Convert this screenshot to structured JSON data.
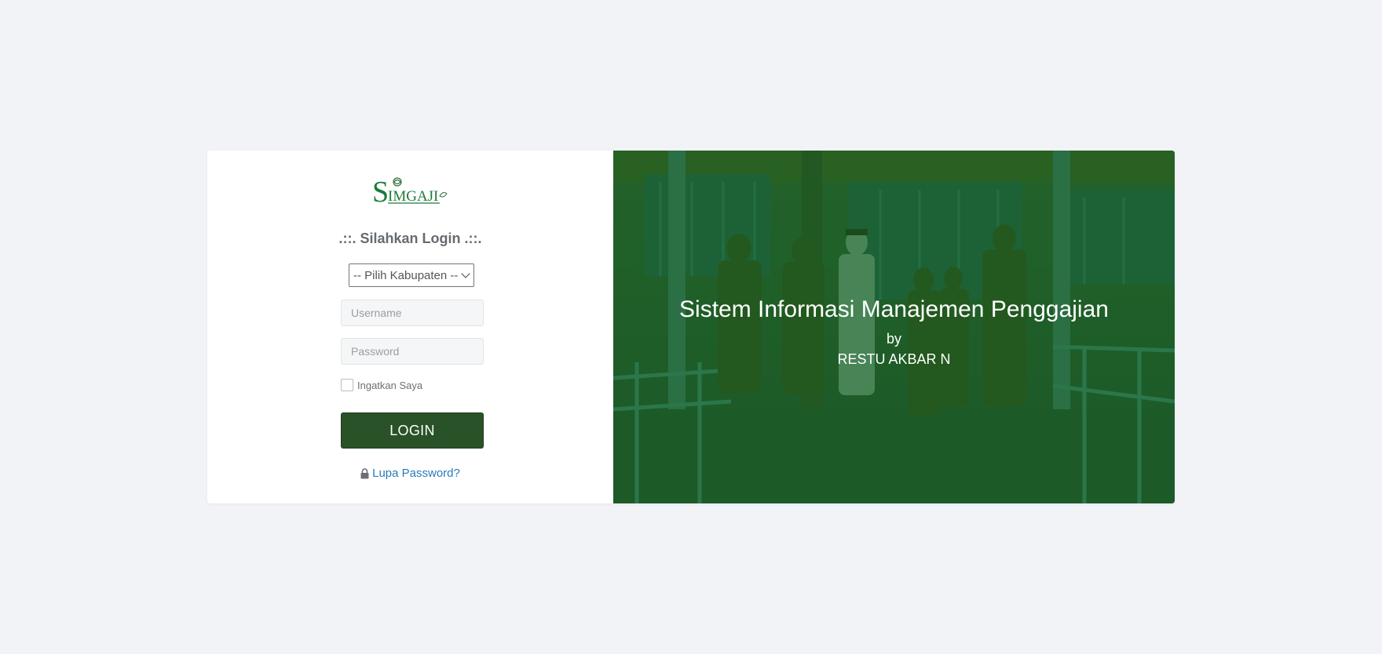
{
  "brand": {
    "logo_text": "SIMGAJI"
  },
  "login_form": {
    "title": ".::. Silahkan Login .::.",
    "kabupaten_select": {
      "selected": "-- Pilih Kabupaten --"
    },
    "username": {
      "placeholder": "Username",
      "value": ""
    },
    "password": {
      "placeholder": "Password",
      "value": ""
    },
    "remember_label": "Ingatkan Saya",
    "remember_checked": false,
    "login_button": "LOGIN",
    "forgot_password": "Lupa Password?"
  },
  "hero": {
    "title": "Sistem Informasi Manajemen Penggajian",
    "by": "by",
    "author": "RESTU AKBAR N"
  },
  "colors": {
    "background": "#f2f3f7",
    "primary_button": "#2a5228",
    "link": "#2a7ab8",
    "hero_overlay": "#0f5a1e",
    "logo_green": "#1e7a3a"
  },
  "icons": {
    "forgot_icon": "lock-icon",
    "select_icon": "chevron-down-icon"
  }
}
